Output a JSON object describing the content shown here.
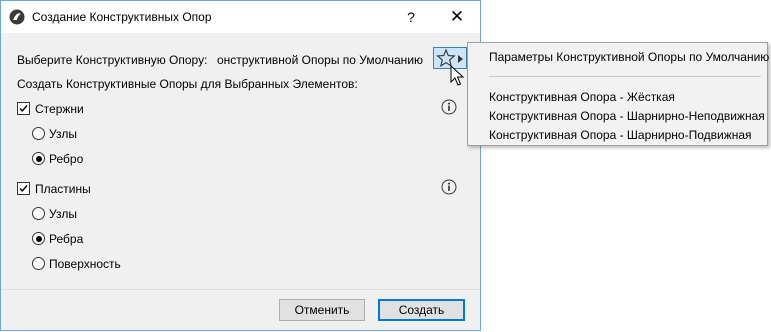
{
  "window": {
    "title": "Создание Конструктивных Опор",
    "help_label": "?",
    "close_label": "✕"
  },
  "support": {
    "label": "Выберите Конструктивную Опору:",
    "value": "онструктивной Опоры по Умолчанию"
  },
  "create_for_label": "Создать Конструктивные Опоры для Выбранных Элементов:",
  "rods": {
    "label": "Стержни",
    "checked": true,
    "options": [
      {
        "label": "Узлы",
        "selected": false
      },
      {
        "label": "Ребро",
        "selected": true
      }
    ]
  },
  "plates": {
    "label": "Пластины",
    "checked": true,
    "options": [
      {
        "label": "Узлы",
        "selected": false
      },
      {
        "label": "Ребра",
        "selected": true
      },
      {
        "label": "Поверхность",
        "selected": false
      }
    ]
  },
  "buttons": {
    "cancel": "Отменить",
    "create": "Создать"
  },
  "popup_menu": {
    "items": [
      "Параметры Конструктивной Опоры по Умолчанию",
      "Конструктивная Опора - Жёсткая",
      "Конструктивная Опора - Шарнирно-Неподвижная",
      "Конструктивная Опора - Шарнирно-Подвижная"
    ]
  },
  "colors": {
    "accent": "#0078d7",
    "selected_button": "#cce4f7",
    "dialog_bg": "#f0f0f0"
  }
}
